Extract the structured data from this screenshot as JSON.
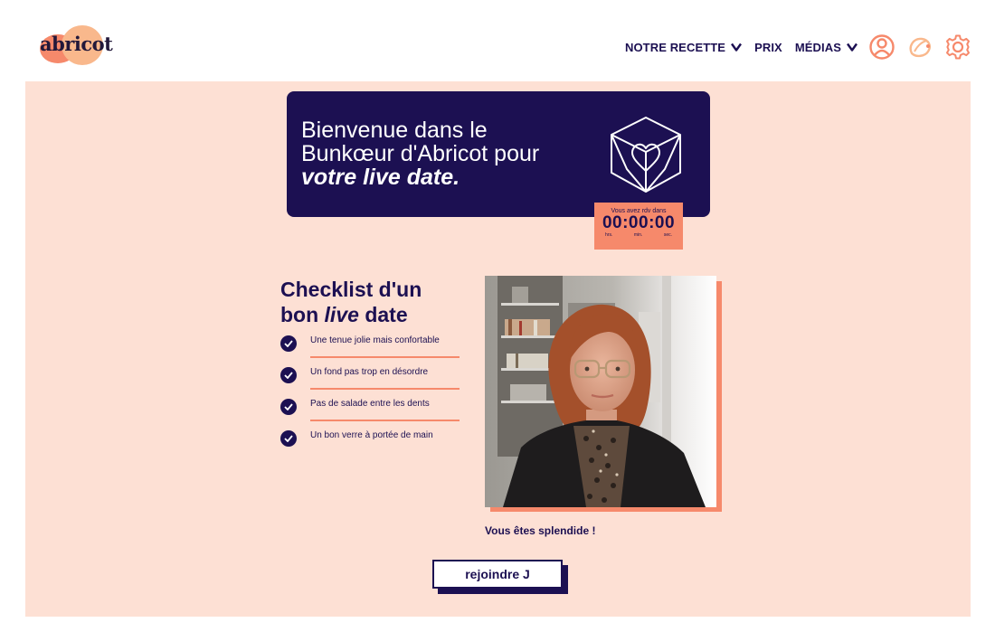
{
  "header": {
    "logo_text": "abricot",
    "nav": [
      {
        "label": "NOTRE RECETTE",
        "icon": "chevron-down-icon"
      },
      {
        "label": "PRIX"
      },
      {
        "label": "MÉDIAS",
        "icon": "chevron-down-icon"
      }
    ],
    "icons": [
      "user-icon",
      "apricot-icon",
      "gear-icon"
    ]
  },
  "welcome": {
    "line1": "Bienvenue dans le",
    "line2": "Bunkœur d'Abricot pour",
    "line3": "votre live date.",
    "icon": "heart-cube-icon"
  },
  "countdown": {
    "label": "Vous avez rdv dans",
    "time": "00:00:00",
    "units": [
      "hrs.",
      "min.",
      "sec."
    ]
  },
  "checklist": {
    "title_line1": "Checklist d'un",
    "title_word": "bon",
    "title_live": "live",
    "title_end": "date",
    "items": [
      "Une tenue jolie mais confortable",
      "Un fond pas trop en désordre",
      "Pas de salade entre les dents",
      "Un bon verre à portée de main"
    ]
  },
  "video": {
    "caption": "Vous êtes splendide !"
  },
  "join_button": "rejoindre J",
  "colors": {
    "navy": "#1c1052",
    "peach_bg": "#fde0d4",
    "coral": "#f6896b",
    "apricot": "#f9b88c"
  }
}
